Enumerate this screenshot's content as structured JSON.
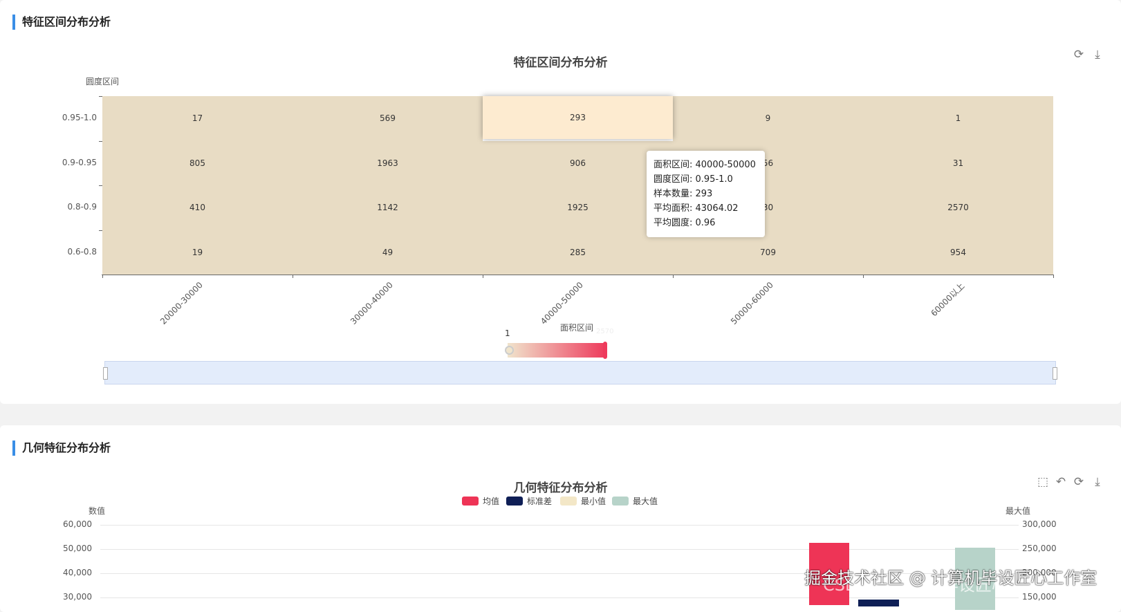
{
  "section1": {
    "title": "特征区间分布分析",
    "chart_title": "特征区间分布分析",
    "y_axis_name": "圆度区间",
    "x_axis_name": "面积区间",
    "rows": [
      "0.95-1.0",
      "0.9-0.95",
      "0.8-0.9",
      "0.6-0.8"
    ],
    "cols": [
      "20000-30000",
      "30000-40000",
      "40000-50000",
      "50000-60000",
      "60000以上"
    ],
    "cells": [
      [
        "17",
        "569",
        "293",
        "9",
        "1"
      ],
      [
        "805",
        "1963",
        "906",
        "56",
        "31"
      ],
      [
        "410",
        "1142",
        "1925",
        "30",
        "2570"
      ],
      [
        "19",
        "49",
        "285",
        "709",
        "954"
      ]
    ],
    "tooltip": [
      "面积区间: 40000-50000",
      "圆度区间: 0.95-1.0",
      "样本数量: 293",
      "平均面积: 43064.02",
      "平均圆度: 0.96"
    ],
    "visual_map": {
      "min": "1",
      "max": "2570",
      "range_fraction": [
        0,
        1
      ]
    },
    "colors": {
      "cell": "#e8dcc4",
      "highlight": "#fdebd0",
      "vm_low": "#f0e4cc",
      "vm_high": "#ee3a5c",
      "zoom": "#e3ecfb"
    }
  },
  "section2": {
    "title": "几何特征分布分析",
    "chart_title": "几何特征分布分析",
    "legend": [
      {
        "label": "均值",
        "color": "#ee3456"
      },
      {
        "label": "标准差",
        "color": "#0f1f56"
      },
      {
        "label": "最小值",
        "color": "#f3e7c7"
      },
      {
        "label": "最大值",
        "color": "#b7d3c9"
      }
    ],
    "left_axis_name": "数值",
    "right_axis_name": "最大值",
    "left_ticks": [
      "60,000",
      "50,000",
      "40,000",
      "30,000"
    ],
    "right_ticks": [
      "300,000",
      "250,000",
      "200,000",
      "150,000"
    ]
  },
  "watermark": {
    "text": "掘金技术社区 @ 计算机毕设匠心工作室",
    "faded": "CSDN @计算机毕设匠心工作室"
  }
}
